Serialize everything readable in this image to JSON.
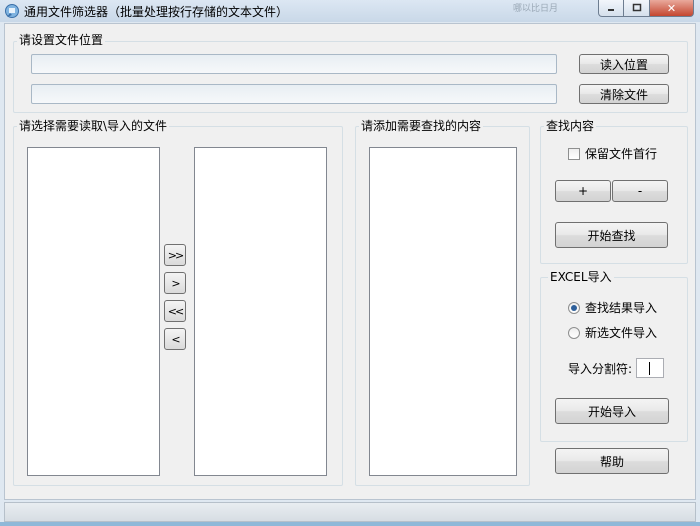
{
  "window": {
    "title": "通用文件筛选器（批量处理按行存储的文本文件）",
    "ghost_text": "哪以比日月",
    "min_icon": "minimize-icon",
    "max_icon": "maximize-icon",
    "close_icon": "close-icon",
    "close_glyph": "✕"
  },
  "location": {
    "group_label": "请设置文件位置",
    "path_value": "",
    "second_value": "",
    "read_button": "读入位置",
    "clear_button": "清除文件"
  },
  "files": {
    "group_label": "请选择需要读取\\导入的文件",
    "move_all_right": ">>",
    "move_right": ">",
    "move_all_left": "<<",
    "move_left": "<"
  },
  "content": {
    "group_label": "请添加需要查找的内容"
  },
  "search": {
    "group_label": "查找内容",
    "keep_first_line": "保留文件首行",
    "keep_first_line_checked": false,
    "plus_button": "+",
    "minus_button": "-",
    "start_button": "开始查找"
  },
  "excel": {
    "group_label": "EXCEL导入",
    "option_results": "查找结果导入",
    "option_new_files": "新选文件导入",
    "selected": "查找结果导入",
    "separator_label": "导入分割符:",
    "separator_value": "",
    "start_button": "开始导入"
  },
  "help_button": "帮助",
  "colors": {
    "title_bar": "#c9d8e8",
    "client_bg": "#f0f0f0",
    "close_button": "#c4462f",
    "radio_dot": "#2d5f9a"
  }
}
